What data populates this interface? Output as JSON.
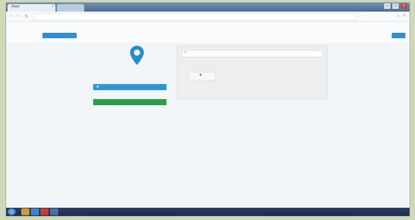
{
  "browser": {
    "active_tab_title": "Fleet",
    "new_tab_label": "",
    "address": "",
    "nav": {
      "back": "‹",
      "forward": "›",
      "reload": "↻"
    },
    "icons": [
      "star-icon",
      "menu-icon"
    ]
  },
  "app": {
    "user_line": "",
    "top_button_label": "",
    "top_right_link": "",
    "top_right_button": ""
  },
  "location": {
    "name": "",
    "sub": "",
    "blue_button_label": "",
    "green_button_label": ""
  },
  "panel": {
    "search_placeholder": "",
    "title": "",
    "subtitle": ""
  },
  "taskbar": {
    "tray_text": ""
  },
  "colors": {
    "accent_blue": "#2a96d4",
    "accent_green": "#2f9e4a",
    "pin": "#1f8fd1"
  }
}
